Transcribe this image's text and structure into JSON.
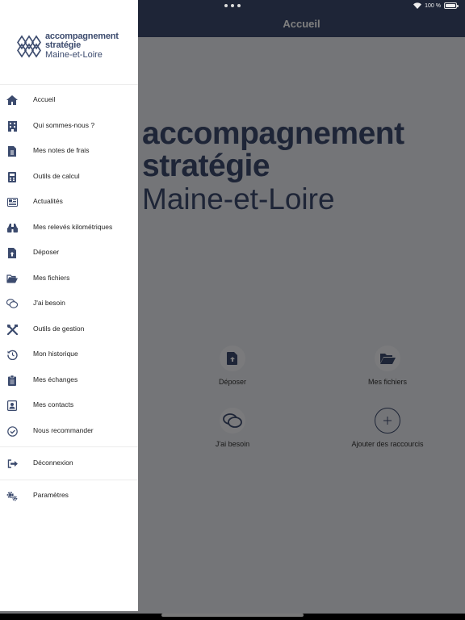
{
  "status_bar": {
    "battery": "100 %"
  },
  "app": {
    "title": "Accueil",
    "hero": {
      "line1": "accompagnement",
      "line2": "stratégie",
      "line3": "Maine-et-Loire"
    },
    "shortcuts": [
      {
        "label": "Déposer",
        "icon": "file-upload-icon"
      },
      {
        "label": "Mes fichiers",
        "icon": "folder-open-icon"
      },
      {
        "label": "J'ai besoin",
        "icon": "comments-icon"
      },
      {
        "label": "Ajouter des raccourcis",
        "icon": "plus-icon"
      }
    ]
  },
  "drawer": {
    "logo": {
      "line1": "accompagnement",
      "line2": "stratégie",
      "line3": "Maine-et-Loire"
    },
    "items": [
      {
        "label": "Accueil",
        "icon": "home-icon"
      },
      {
        "label": "Qui sommes-nous ?",
        "icon": "building-icon"
      },
      {
        "label": "Mes notes de frais",
        "icon": "receipt-icon"
      },
      {
        "label": "Outils de calcul",
        "icon": "calculator-icon"
      },
      {
        "label": "Actualités",
        "icon": "newspaper-icon"
      },
      {
        "label": "Mes relevés kilométriques",
        "icon": "binoculars-icon"
      },
      {
        "label": "Déposer",
        "icon": "file-upload-icon"
      },
      {
        "label": "Mes fichiers",
        "icon": "folder-open-icon"
      },
      {
        "label": "J'ai besoin",
        "icon": "comments-icon"
      },
      {
        "label": "Outils de gestion",
        "icon": "tools-icon"
      },
      {
        "label": "Mon historique",
        "icon": "history-icon"
      },
      {
        "label": "Mes échanges",
        "icon": "clipboard-icon"
      },
      {
        "label": "Mes contacts",
        "icon": "address-book-icon"
      },
      {
        "label": "Nous recommander",
        "icon": "check-circle-icon"
      }
    ],
    "logout": {
      "label": "Déconnexion",
      "icon": "sign-out-icon"
    },
    "settings": {
      "label": "Paramètres",
      "icon": "cogs-icon"
    }
  },
  "colors": {
    "brand": "#3c4b6e",
    "nav_bg": "#3c4b6e",
    "overlay": "rgba(0,0,0,0.5)"
  }
}
